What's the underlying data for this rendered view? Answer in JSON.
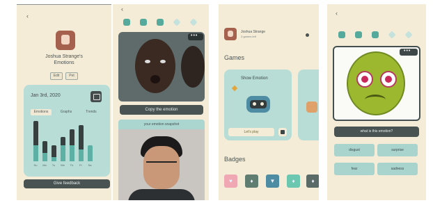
{
  "screen1": {
    "back": "‹",
    "title_line1": "Joshua Strange's",
    "title_line2": "Emotions",
    "tags": [
      "Edit",
      "Pet"
    ],
    "date_range": "Jan 3rd, 2020",
    "segments": [
      "Emotions",
      "Graphs",
      "Trends"
    ],
    "chart_data": {
      "type": "bar",
      "categories": [
        "Su",
        "Mo",
        "Tu",
        "We",
        "Th",
        "Fr",
        "Sa"
      ],
      "series": [
        {
          "values": [
            10,
            5,
            4,
            6,
            8,
            9,
            4
          ]
        },
        {
          "values": [
            6,
            3,
            3,
            2,
            4,
            6,
            0
          ]
        }
      ],
      "ylim": [
        0,
        10
      ],
      "colors": [
        "#5cb0a4",
        "#38403f"
      ]
    },
    "bottom_button": "Give feedback"
  },
  "screen2": {
    "back": "‹",
    "progress": {
      "done": 3,
      "total": 5
    },
    "menu": "•••",
    "copy_button": "Copy the emotion",
    "camera_caption": "your emotion snapshot"
  },
  "screen3": {
    "profile_name": "Joshua Strange",
    "profile_sub": "3 games left",
    "games_heading": "Games",
    "game_title": "Show Emotion",
    "game_button": "Let's play",
    "badges_heading": "Badges",
    "badge_colors": [
      "#f0a7b4",
      "#5f7d70",
      "#4d8ca3",
      "#6cc7b1",
      "#5a6a66"
    ]
  },
  "screen4": {
    "back": "‹",
    "menu": "•••",
    "question": "what is this emotion?",
    "answers": [
      "disgust",
      "surprise",
      "fear",
      "sadness"
    ]
  }
}
